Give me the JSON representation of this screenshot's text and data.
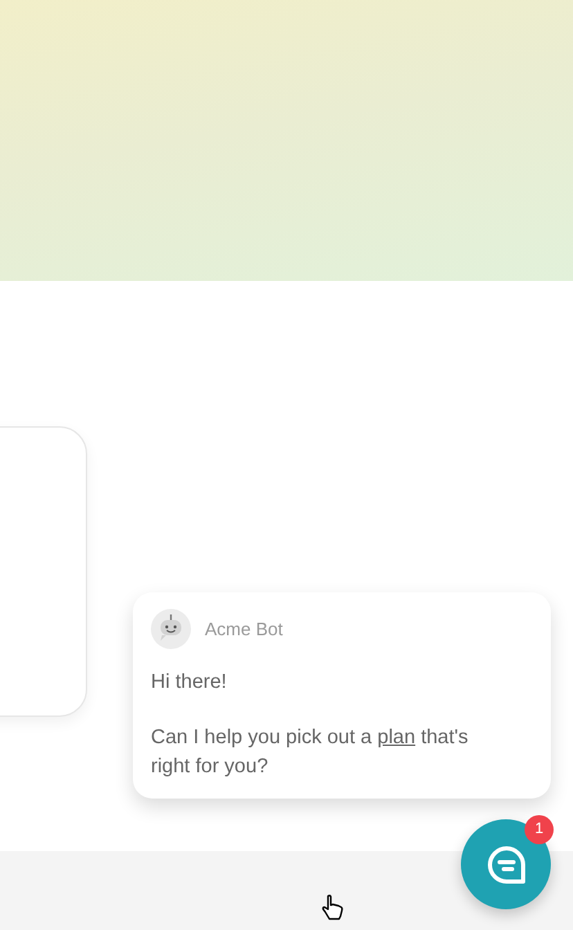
{
  "chat_popup": {
    "sender": "Acme Bot",
    "greeting": "Hi there!",
    "question": {
      "before": "Can I help you pick out a ",
      "link": "plan",
      "after": " that's right for you?"
    }
  },
  "launcher": {
    "badge": "1"
  }
}
